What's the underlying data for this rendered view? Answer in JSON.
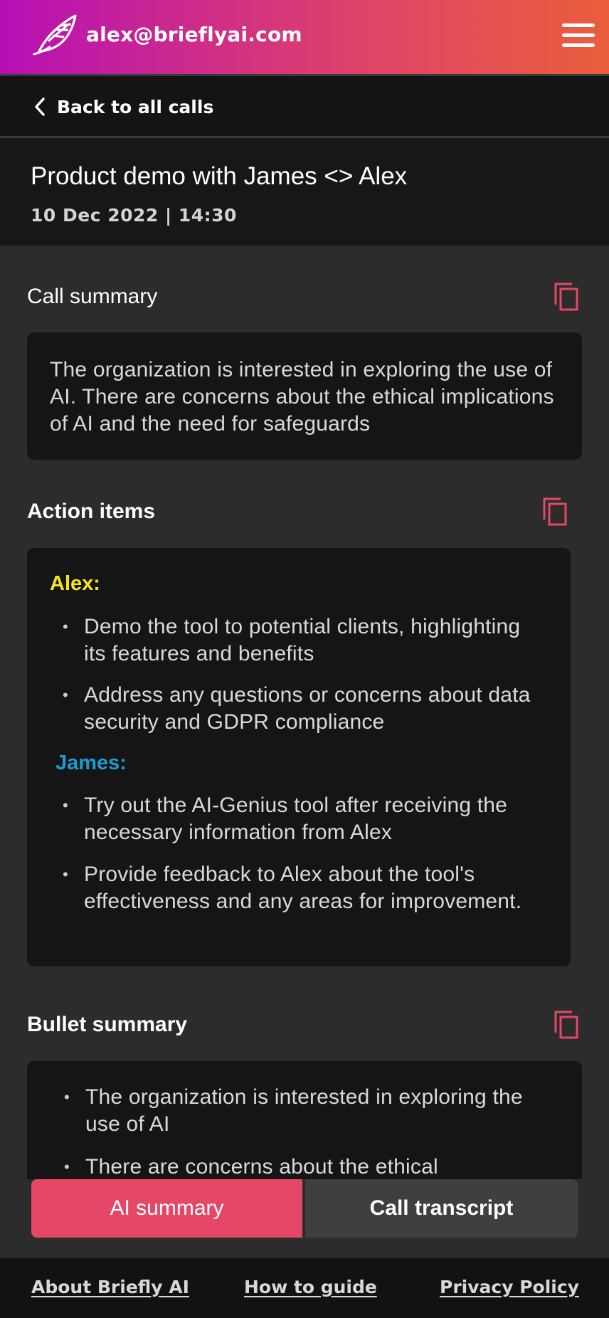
{
  "header": {
    "email": "alex@brieflyai.com",
    "gradient_start": "#b60fb6",
    "gradient_end": "#ea5e3c",
    "logo_icon": "feather-logo-icon",
    "menu_icon": "hamburger-menu-icon"
  },
  "nav": {
    "back_label": "Back to all calls",
    "back_icon": "chevron-left-icon"
  },
  "call": {
    "title": "Product demo with James <> Alex",
    "datetime": "10 Dec 2022 | 14:30"
  },
  "sections": {
    "summary": {
      "heading": "Call summary",
      "copy_icon": "copy-icon",
      "text": "The organization is interested in exploring the use of AI. There are concerns about the ethical implications of AI and the need for safeguards"
    },
    "action_items": {
      "heading": "Action items",
      "copy_icon": "copy-icon",
      "people": [
        {
          "name": "Alex:",
          "color": "#f5e61c",
          "items": [
            "Demo the tool to potential clients, highlighting its features and benefits",
            "Address any questions or concerns about data security and GDPR compliance"
          ]
        },
        {
          "name": "James:",
          "color": "#1e9bd4",
          "items": [
            "Try out the AI-Genius tool after receiving the necessary information from Alex",
            "Provide feedback to Alex about the tool's effectiveness and any areas for improvement."
          ]
        }
      ]
    },
    "bullet_summary": {
      "heading": "Bullet summary",
      "copy_icon": "copy-icon",
      "items": [
        "The organization is interested in exploring the use of AI",
        "There are concerns about the ethical"
      ]
    }
  },
  "tabs": {
    "ai_summary": "AI summary",
    "call_transcript": "Call transcript",
    "active_color": "#e54866"
  },
  "footer": {
    "about": "About Briefly AI",
    "guide": "How to guide",
    "privacy": "Privacy Policy"
  },
  "accent_icon_color": "#e54866"
}
